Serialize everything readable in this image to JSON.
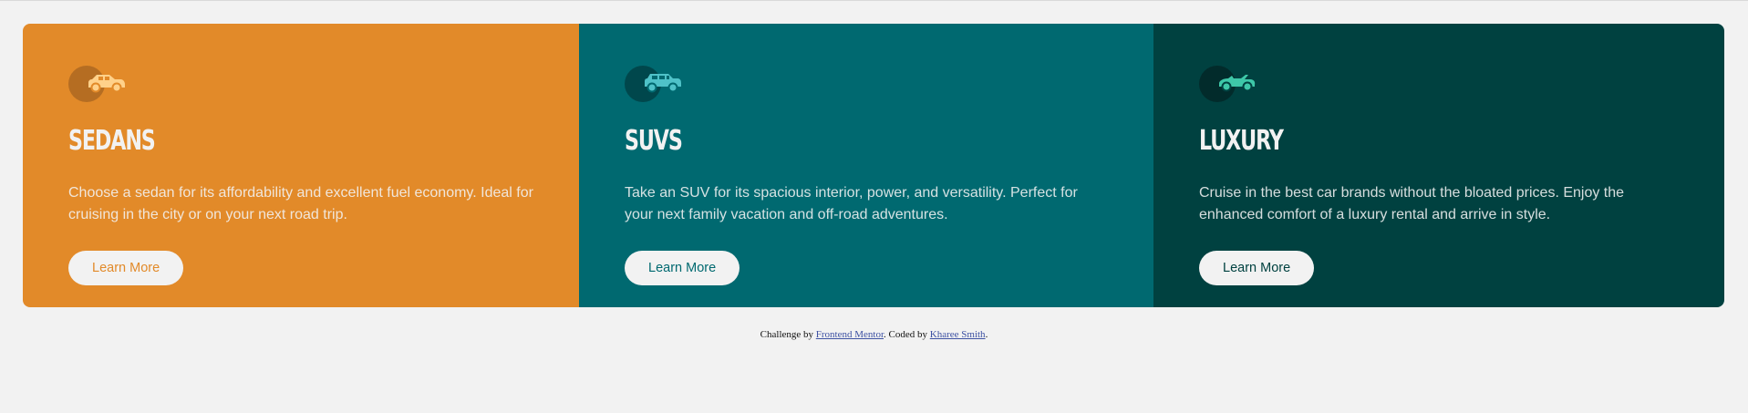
{
  "cards": [
    {
      "icon": "sedan-car-icon",
      "title": "SEDANS",
      "description": "Choose a sedan for its affordability and excellent fuel economy. Ideal for cruising in the city or on your next road trip.",
      "button_label": "Learn More",
      "color": "#e28a29"
    },
    {
      "icon": "suv-car-icon",
      "title": "SUVS",
      "description": "Take an SUV for its spacious interior, power, and versatility. Perfect for your next family vacation and off-road adventures.",
      "button_label": "Learn More",
      "color": "#006970"
    },
    {
      "icon": "luxury-car-icon",
      "title": "LUXURY",
      "description": "Cruise in the best car brands without the bloated prices. Enjoy the enhanced comfort of a luxury rental and arrive in style.",
      "button_label": "Learn More",
      "color": "#004140"
    }
  ],
  "attribution": {
    "prefix": "Challenge by",
    "challenge_link": "Frontend Mentor",
    "middle": ". Coded by",
    "author_link": "Kharee Smith",
    "suffix": "."
  },
  "colors": {
    "background": "#f2f2f2",
    "text_light": "#f2f2f2",
    "link": "#3e52a3"
  }
}
